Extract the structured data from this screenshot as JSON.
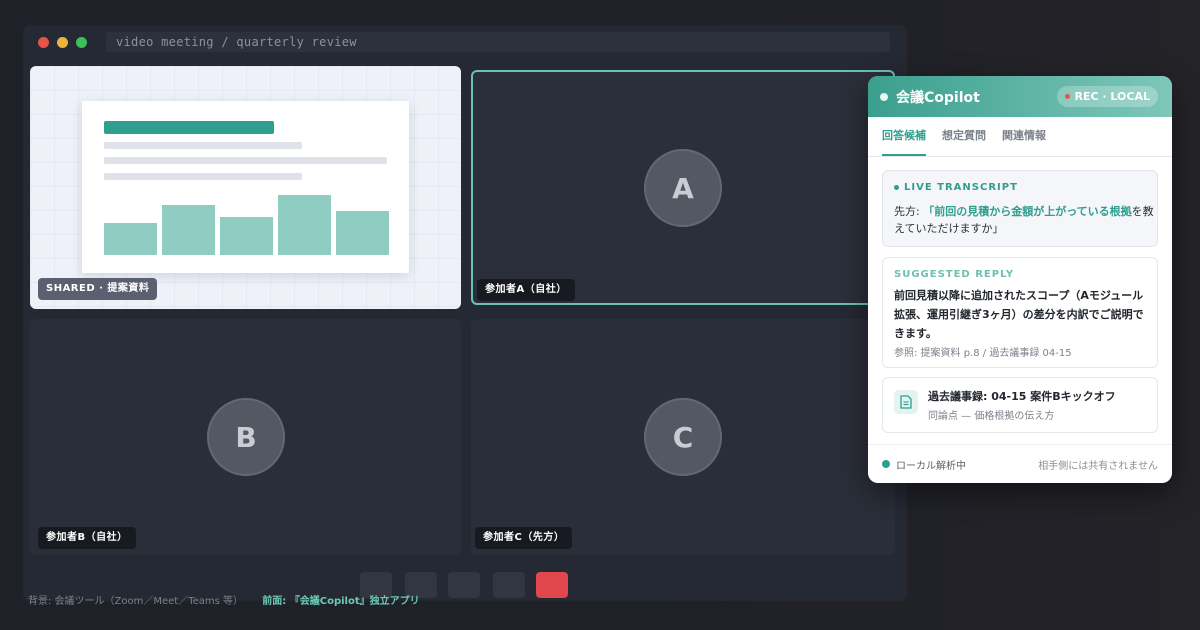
{
  "window": {
    "title": "video meeting / quarterly review"
  },
  "tiles": {
    "shared_label": "SHARED · 提案資料",
    "a": {
      "initial": "A",
      "label": "参加者A（自社）"
    },
    "b": {
      "initial": "B",
      "label": "参加者B（自社）"
    },
    "c": {
      "initial": "C",
      "label": "参加者C（先方）"
    }
  },
  "bg_note": {
    "background": "背景: 会議ツール（Zoom／Meet／Teams 等）",
    "front": "前面: 『会議Copilot』独立アプリ"
  },
  "panel": {
    "title": "会議Copilot",
    "rec": "REC · LOCAL",
    "tabs": [
      "回答候補",
      "想定質問",
      "関連情報"
    ],
    "transcript": {
      "label": "LIVE TRANSCRIPT",
      "speaker": "先方: ",
      "highlight": "「前回の見積から金額が上がっている根拠",
      "rest": "を教えていただけますか」"
    },
    "reply": {
      "label": "SUGGESTED REPLY",
      "text": "前回見積以降に追加されたスコープ（Aモジュール拡張、運用引継ぎ3ヶ月）の差分を内訳でご説明できます。",
      "ref": "参照: 提案資料 p.8 / 過去議事録 04-15"
    },
    "ref_card": {
      "title": "過去議事録: 04-15 案件Bキックオフ",
      "sub": "同論点 — 価格根拠の伝え方",
      "icon": "document-icon"
    },
    "footer": {
      "status": "ローカル解析中",
      "note": "相手側には共有されません"
    }
  },
  "colors": {
    "accent": "#2f9e8e",
    "end_call": "#e0464c"
  },
  "slide_chart": {
    "type": "bar",
    "values": [
      0.53,
      0.83,
      0.63,
      1.0,
      0.73
    ]
  }
}
